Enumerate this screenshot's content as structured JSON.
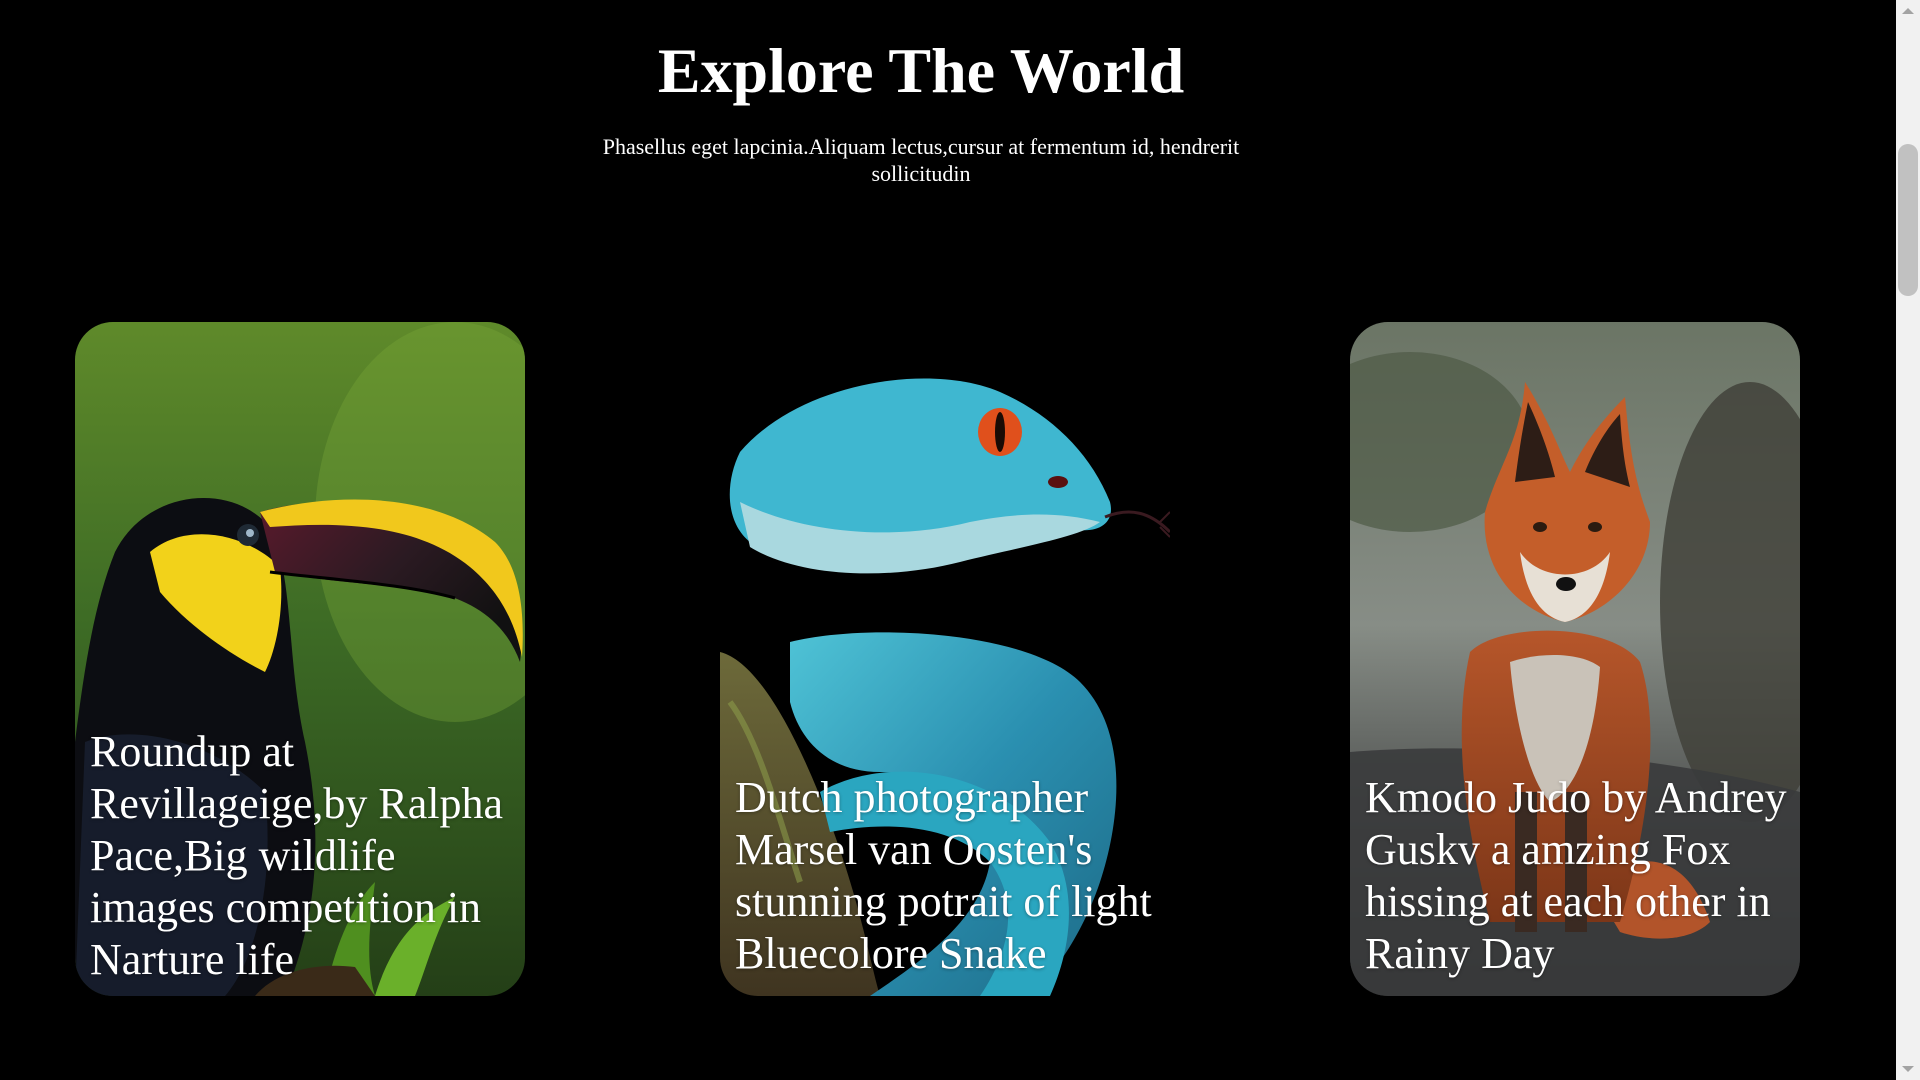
{
  "header": {
    "title": "Explore The World",
    "subtitle": "Phasellus eget lapcinia.Aliquam lectus,cursur at fermentum id, hendrerit sollicitudin"
  },
  "cards": [
    {
      "subject": "toucan-photo",
      "caption": "Roundup at Revillageige,by Ralpha Pace,Big wildlife images competition in Narture life"
    },
    {
      "subject": "blue-snake-photo",
      "caption": "Dutch photographer Marsel van Oosten's stunning potrait of light Bluecolore Snake"
    },
    {
      "subject": "red-fox-photo",
      "caption": "Kmodo Judo by Andrey Guskv a amzing Fox hissing at each other in Rainy Day"
    }
  ],
  "colors": {
    "background": "#000000",
    "text": "#ffffff",
    "scrollbar_track": "#f1f1f1",
    "scrollbar_thumb": "#c1c1c1"
  }
}
